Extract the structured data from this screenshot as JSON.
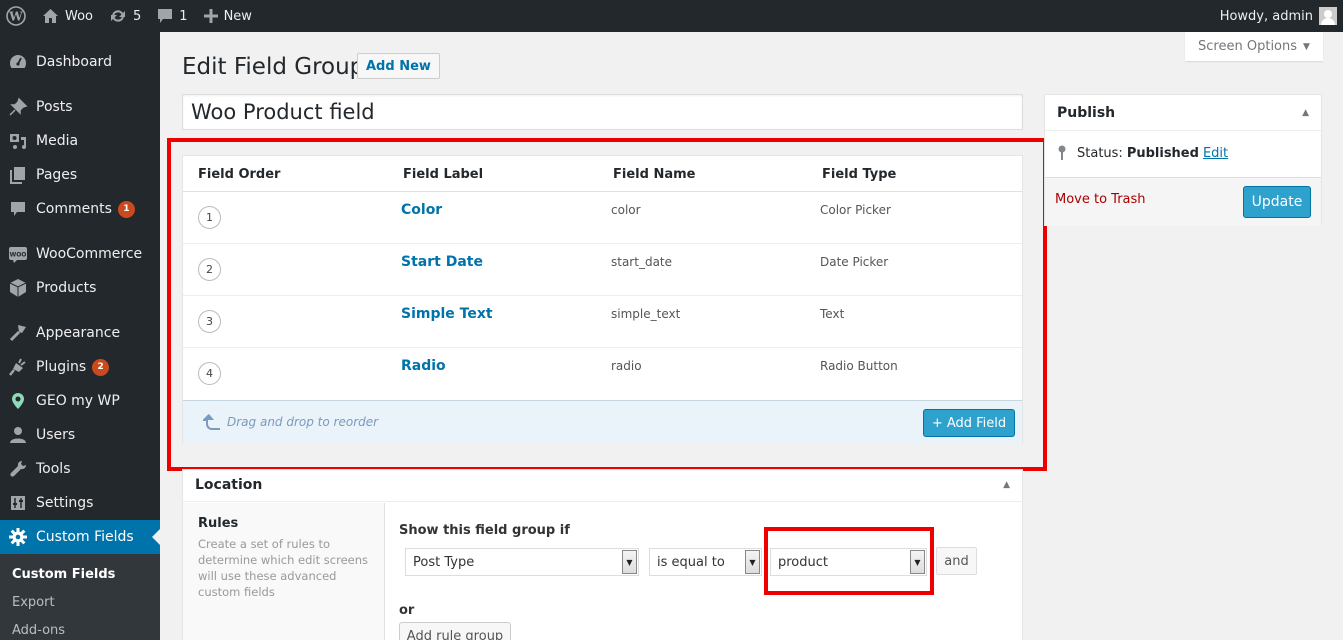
{
  "admin_bar": {
    "site_name": "Woo",
    "updates_count": "5",
    "comments_count": "1",
    "new_label": "New",
    "greeting": "Howdy, admin"
  },
  "sidebar": {
    "items": [
      {
        "label": "Dashboard",
        "icon": "dashboard-icon"
      },
      {
        "label": "Posts",
        "icon": "pin-icon"
      },
      {
        "label": "Media",
        "icon": "media-icon"
      },
      {
        "label": "Pages",
        "icon": "pages-icon"
      },
      {
        "label": "Comments",
        "icon": "comment-icon",
        "badge": "1"
      },
      {
        "label": "WooCommerce",
        "icon": "woo-icon"
      },
      {
        "label": "Products",
        "icon": "box-icon"
      },
      {
        "label": "Appearance",
        "icon": "brush-icon"
      },
      {
        "label": "Plugins",
        "icon": "plug-icon",
        "badge": "2"
      },
      {
        "label": "GEO my WP",
        "icon": "location-pin-icon"
      },
      {
        "label": "Users",
        "icon": "user-icon"
      },
      {
        "label": "Tools",
        "icon": "wrench-icon"
      },
      {
        "label": "Settings",
        "icon": "sliders-icon"
      },
      {
        "label": "Custom Fields",
        "icon": "gear-icon",
        "active": true
      }
    ],
    "submenu": [
      "Custom Fields",
      "Export",
      "Add-ons"
    ]
  },
  "header": {
    "screen_options": "Screen Options",
    "page_title": "Edit Field Group",
    "add_new": "Add New",
    "title_value": "Woo Product field"
  },
  "fields": {
    "columns": [
      "Field Order",
      "Field Label",
      "Field Name",
      "Field Type"
    ],
    "rows": [
      {
        "order": "1",
        "label": "Color",
        "name": "color",
        "type": "Color Picker"
      },
      {
        "order": "2",
        "label": "Start Date",
        "name": "start_date",
        "type": "Date Picker"
      },
      {
        "order": "3",
        "label": "Simple Text",
        "name": "simple_text",
        "type": "Text"
      },
      {
        "order": "4",
        "label": "Radio",
        "name": "radio",
        "type": "Radio Button"
      }
    ],
    "drag_hint": "Drag and drop to reorder",
    "add_field": "+ Add Field"
  },
  "location": {
    "title": "Location",
    "rules_title": "Rules",
    "rules_desc": "Create a set of rules to determine which edit screens will use these advanced custom fields",
    "show_if": "Show this field group if",
    "param": "Post Type",
    "operator": "is equal to",
    "value": "product",
    "and_label": "and",
    "or_label": "or",
    "add_rule_group": "Add rule group"
  },
  "publish": {
    "title": "Publish",
    "status_label": "Status:",
    "status_value": "Published",
    "edit_label": "Edit",
    "trash_label": "Move to Trash",
    "update_label": "Update"
  },
  "colors": {
    "accent": "#0073aa",
    "button": "#2ea2cc",
    "highlight": "#e00000",
    "trash": "#aa0000"
  }
}
